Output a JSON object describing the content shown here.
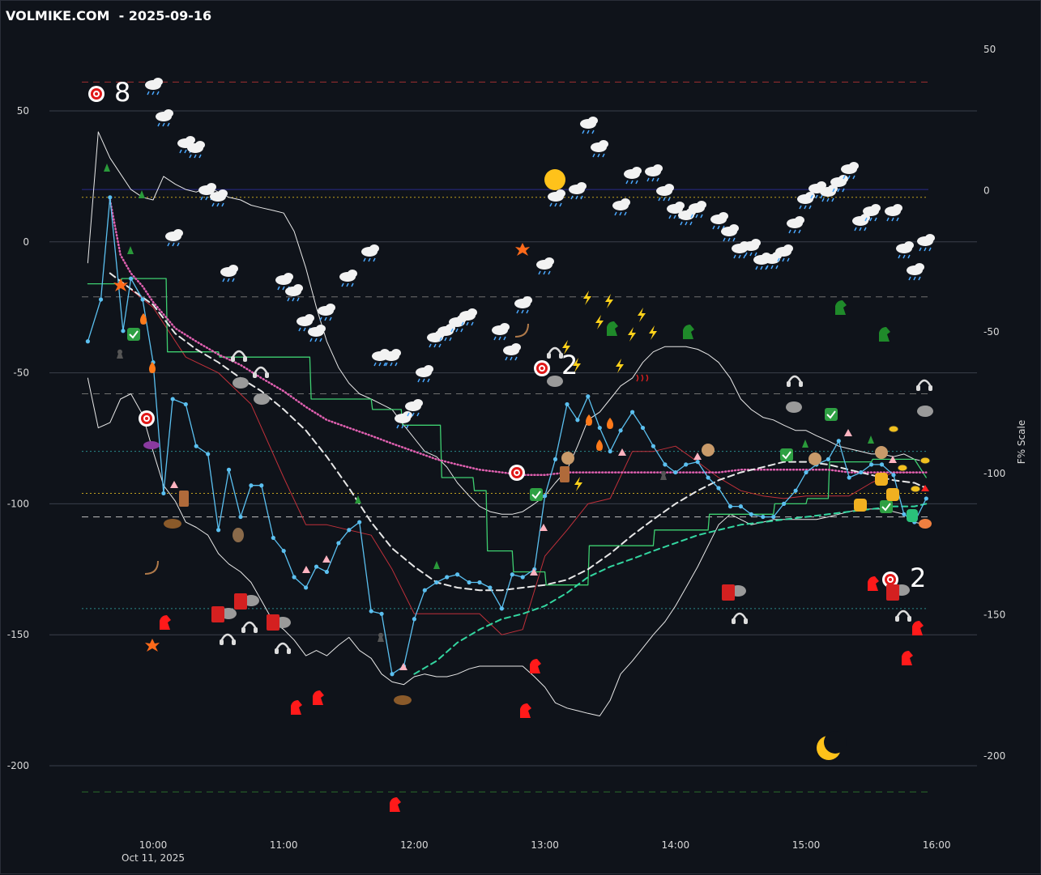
{
  "header": {
    "title": "VOLMIKE.COM  - 2025-09-16"
  },
  "chart_data": {
    "type": "line",
    "title": "VOLMIKE.COM  - 2025-09-16",
    "x_date_label": "Oct 11, 2025",
    "x_ticks": [
      "10:00",
      "11:00",
      "12:00",
      "13:00",
      "14:00",
      "15:00",
      "16:00"
    ],
    "y_left_ticks": [
      "50",
      "0",
      "-50",
      "-100",
      "-150",
      "-200"
    ],
    "y_left_values": [
      50,
      0,
      -50,
      -100,
      -150,
      -200
    ],
    "y_left_range": [
      -220,
      62
    ],
    "y_right_label": "F% Scale",
    "y_right_ticks": [
      "50",
      "0",
      "-50",
      "-100",
      "-150",
      "-200"
    ],
    "y_right_values": [
      50,
      0,
      -50,
      -100,
      -150,
      -200
    ],
    "y_right_range": [
      -215,
      50
    ],
    "grid": true,
    "colors": {
      "background": "#0f131a",
      "price": "#5bc0f0",
      "bands": "#e8e8e8",
      "pink": "#e060b0",
      "green": "#3ecf70",
      "red": "#c0303a",
      "purple": "#8a2a9a",
      "teal": "#33d6a0",
      "white_dash": "#e8e8e8"
    },
    "hlines": [
      {
        "y": 61,
        "color": "#a03030",
        "style": "dash"
      },
      {
        "y": 20,
        "color": "#2a2a8a",
        "style": "solid"
      },
      {
        "y": 17,
        "color": "#c0a020",
        "style": "dot"
      },
      {
        "y": -21,
        "color": "#707070",
        "style": "dash"
      },
      {
        "y": -58,
        "color": "#707070",
        "style": "dash"
      },
      {
        "y": -80,
        "color": "#2a8a8a",
        "style": "dot"
      },
      {
        "y": -96,
        "color": "#c0a020",
        "style": "dot"
      },
      {
        "y": -105,
        "color": "#c0c0c0",
        "style": "dash"
      },
      {
        "y": -140,
        "color": "#2a8a8a",
        "style": "dot"
      },
      {
        "y": -210,
        "color": "#2a6a2a",
        "style": "dash"
      }
    ],
    "series": [
      {
        "key": "price",
        "x": [
          9.5,
          9.6,
          9.67,
          9.77,
          9.83,
          9.92,
          10.0,
          10.08,
          10.15,
          10.25,
          10.33,
          10.42,
          10.5,
          10.58,
          10.67,
          10.75,
          10.83,
          10.92,
          11.0,
          11.08,
          11.17,
          11.25,
          11.33,
          11.42,
          11.5,
          11.58,
          11.67,
          11.75,
          11.83,
          11.92,
          12.0,
          12.08,
          12.17,
          12.25,
          12.33,
          12.42,
          12.5,
          12.58,
          12.67,
          12.75,
          12.83,
          12.92,
          13.0,
          13.08,
          13.17,
          13.25,
          13.33,
          13.42,
          13.5,
          13.58,
          13.67,
          13.75,
          13.83,
          13.92,
          14.0,
          14.08,
          14.17,
          14.25,
          14.33,
          14.42,
          14.5,
          14.58,
          14.67,
          14.75,
          14.83,
          14.92,
          15.0,
          15.08,
          15.17,
          15.25,
          15.33,
          15.42,
          15.5,
          15.58,
          15.67,
          15.75,
          15.83,
          15.92
        ],
        "y": [
          -38,
          -22,
          17,
          -34,
          -14,
          -22,
          -46,
          -96,
          -60,
          -62,
          -78,
          -81,
          -110,
          -87,
          -105,
          -93,
          -93,
          -113,
          -118,
          -128,
          -132,
          -124,
          -126,
          -115,
          -110,
          -107,
          -141,
          -142,
          -165,
          -162,
          -144,
          -133,
          -130,
          -128,
          -127,
          -130,
          -130,
          -132,
          -140,
          -127,
          -128,
          -125,
          -97,
          -83,
          -62,
          -68,
          -59,
          -71,
          -80,
          -72,
          -65,
          -71,
          -78,
          -85,
          -88,
          -85,
          -84,
          -90,
          -94,
          -101,
          -101,
          -104,
          -105,
          -105,
          -100,
          -95,
          -88,
          -85,
          -83,
          -76,
          -90,
          -88,
          -85,
          -85,
          -89,
          -104,
          -107,
          -98
        ]
      },
      {
        "key": "band_upper",
        "x": [
          9.5,
          9.58,
          9.67,
          9.75,
          9.83,
          9.92,
          10.0,
          10.08,
          10.17,
          10.25,
          10.33,
          10.42,
          10.5,
          10.58,
          10.67,
          10.75,
          10.83,
          10.92,
          11.0,
          11.08,
          11.17,
          11.25,
          11.33,
          11.42,
          11.5,
          11.58,
          11.67,
          11.75,
          11.83,
          11.92,
          12.0,
          12.08,
          12.17,
          12.25,
          12.33,
          12.42,
          12.5,
          12.58,
          12.67,
          12.75,
          12.83,
          12.92,
          13.0,
          13.08,
          13.17,
          13.25,
          13.33,
          13.42,
          13.5,
          13.58,
          13.67,
          13.75,
          13.83,
          13.92,
          14.0,
          14.08,
          14.17,
          14.25,
          14.33,
          14.42,
          14.5,
          14.58,
          14.67,
          14.75,
          14.83,
          14.92,
          15.0,
          15.08,
          15.17,
          15.25,
          15.33,
          15.42,
          15.5,
          15.58,
          15.67,
          15.75,
          15.83,
          15.92
        ],
        "y": [
          -8,
          42,
          32,
          26,
          20,
          17,
          16,
          25,
          22,
          20,
          19,
          21,
          19,
          17,
          16,
          14,
          13,
          12,
          11,
          4,
          -10,
          -25,
          -38,
          -48,
          -54,
          -58,
          -60,
          -62,
          -64,
          -70,
          -75,
          -80,
          -82,
          -86,
          -92,
          -97,
          -101,
          -103,
          -104,
          -104,
          -103,
          -100,
          -97,
          -92,
          -87,
          -78,
          -68,
          -65,
          -60,
          -55,
          -52,
          -46,
          -42,
          -40,
          -40,
          -40,
          -41,
          -43,
          -46,
          -52,
          -60,
          -64,
          -67,
          -68,
          -70,
          -72,
          -72,
          -74,
          -76,
          -78,
          -79,
          -80,
          -81,
          -81,
          -82,
          -81,
          -83,
          -84
        ]
      },
      {
        "key": "band_lower",
        "x": [
          9.5,
          9.58,
          9.67,
          9.75,
          9.83,
          9.92,
          10.0,
          10.08,
          10.17,
          10.25,
          10.33,
          10.42,
          10.5,
          10.58,
          10.67,
          10.75,
          10.83,
          10.92,
          11.0,
          11.08,
          11.17,
          11.25,
          11.33,
          11.42,
          11.5,
          11.58,
          11.67,
          11.75,
          11.83,
          11.92,
          12.0,
          12.08,
          12.17,
          12.25,
          12.33,
          12.42,
          12.5,
          12.58,
          12.67,
          12.75,
          12.83,
          12.92,
          13.0,
          13.08,
          13.17,
          13.25,
          13.33,
          13.42,
          13.5,
          13.58,
          13.67,
          13.75,
          13.83,
          13.92,
          14.0,
          14.08,
          14.17,
          14.25,
          14.33,
          14.42,
          14.5,
          14.58,
          14.67,
          14.75,
          14.83,
          14.92,
          15.0,
          15.08,
          15.17,
          15.25,
          15.33,
          15.42,
          15.5,
          15.58,
          15.67,
          15.75,
          15.83,
          15.92
        ],
        "y": [
          -52,
          -71,
          -69,
          -60,
          -58,
          -66,
          -80,
          -93,
          -99,
          -107,
          -109,
          -112,
          -119,
          -123,
          -126,
          -130,
          -137,
          -145,
          -148,
          -152,
          -158,
          -156,
          -158,
          -154,
          -151,
          -156,
          -159,
          -165,
          -168,
          -169,
          -166,
          -165,
          -166,
          -166,
          -165,
          -163,
          -162,
          -162,
          -162,
          -162,
          -162,
          -166,
          -170,
          -176,
          -178,
          -179,
          -180,
          -181,
          -175,
          -165,
          -160,
          -155,
          -150,
          -145,
          -139,
          -132,
          -124,
          -116,
          -108,
          -104,
          -106,
          -108,
          -107,
          -106,
          -106,
          -106,
          -106,
          -106,
          -105,
          -104,
          -103,
          -102,
          -102,
          -102,
          -103,
          -104,
          -107,
          -108
        ]
      },
      {
        "key": "pink_dotted",
        "x": [
          9.67,
          9.75,
          9.83,
          9.92,
          10.0,
          10.17,
          10.33,
          10.5,
          10.67,
          10.83,
          11.0,
          11.17,
          11.33,
          11.5,
          11.67,
          11.83,
          12.0,
          12.17,
          12.33,
          12.5,
          12.67,
          12.83,
          13.0,
          13.17,
          13.33,
          13.5,
          13.67,
          13.83,
          14.0,
          14.17,
          14.33,
          14.5,
          14.67,
          14.83,
          15.0,
          15.17,
          15.33,
          15.5,
          15.67,
          15.83,
          15.92
        ],
        "y": [
          16,
          -5,
          -12,
          -17,
          -23,
          -33,
          -38,
          -43,
          -47,
          -52,
          -57,
          -63,
          -68,
          -71,
          -74,
          -77,
          -80,
          -83,
          -85,
          -87,
          -88,
          -89,
          -89,
          -88,
          -88,
          -88,
          -88,
          -88,
          -88,
          -88,
          -88,
          -87,
          -87,
          -87,
          -87,
          -87,
          -88,
          -88,
          -88,
          -88,
          -88
        ]
      },
      {
        "key": "white_dashed",
        "x": [
          9.67,
          9.83,
          10.0,
          10.17,
          10.33,
          10.5,
          10.67,
          10.83,
          11.0,
          11.17,
          11.33,
          11.5,
          11.67,
          11.83,
          12.0,
          12.17,
          12.33,
          12.5,
          12.67,
          12.83,
          13.0,
          13.17,
          13.33,
          13.5,
          13.67,
          13.83,
          14.0,
          14.17,
          14.33,
          14.5,
          14.67,
          14.83,
          15.0,
          15.17,
          15.33,
          15.5,
          15.67,
          15.83,
          15.92
        ],
        "y": [
          -12,
          -18,
          -24,
          -35,
          -41,
          -46,
          -52,
          -57,
          -64,
          -72,
          -82,
          -94,
          -107,
          -117,
          -124,
          -130,
          -132,
          -133,
          -133,
          -132,
          -131,
          -129,
          -125,
          -119,
          -112,
          -106,
          -100,
          -95,
          -91,
          -88,
          -86,
          -84,
          -84,
          -85,
          -87,
          -89,
          -91,
          -92,
          -94
        ]
      },
      {
        "key": "teal_dashed",
        "x": [
          12.0,
          12.17,
          12.33,
          12.5,
          12.67,
          12.83,
          13.0,
          13.17,
          13.33,
          13.5,
          13.67,
          13.83,
          14.0,
          14.17,
          14.33,
          14.5,
          14.67,
          14.83,
          15.0,
          15.17,
          15.33,
          15.5,
          15.67,
          15.83,
          15.92
        ],
        "y": [
          -165,
          -160,
          -153,
          -148,
          -144,
          -142,
          -139,
          -134,
          -128,
          -124,
          -121,
          -118,
          -115,
          -112,
          -110,
          -108,
          -107,
          -106,
          -105,
          -104,
          -103,
          -102,
          -101,
          -101,
          -100
        ]
      },
      {
        "key": "green_step",
        "x": [
          9.5,
          9.75,
          9.76,
          10.1,
          10.11,
          10.5,
          10.51,
          10.83,
          10.84,
          11.2,
          11.21,
          11.67,
          11.68,
          11.9,
          11.91,
          12.2,
          12.21,
          12.45,
          12.46,
          12.55,
          12.56,
          12.75,
          12.76,
          13.0,
          13.01,
          13.33,
          13.34,
          13.83,
          13.84,
          14.25,
          14.26,
          14.75,
          14.76,
          15.0,
          15.01,
          15.17,
          15.18,
          15.5,
          15.51,
          15.83,
          15.92
        ],
        "y": [
          -16,
          -16,
          -14,
          -14,
          -42,
          -42,
          -44,
          -44,
          -44,
          -44,
          -60,
          -60,
          -64,
          -64,
          -70,
          -70,
          -90,
          -90,
          -95,
          -95,
          -118,
          -118,
          -126,
          -126,
          -131,
          -131,
          -116,
          -116,
          -110,
          -110,
          -104,
          -104,
          -100,
          -100,
          -98,
          -98,
          -84,
          -84,
          -83,
          -83,
          -90
        ]
      },
      {
        "key": "red_line",
        "x": [
          9.75,
          10.0,
          10.25,
          10.5,
          10.75,
          11.0,
          11.17,
          11.33,
          11.5,
          11.67,
          11.83,
          12.0,
          12.17,
          12.33,
          12.5,
          12.67,
          12.83,
          13.0,
          13.17,
          13.33,
          13.5,
          13.67,
          13.83,
          14.0,
          14.17,
          14.33,
          14.5,
          14.67,
          14.83,
          15.0,
          15.17,
          15.33,
          15.5,
          15.67,
          15.83
        ],
        "y": [
          -15,
          -25,
          -44,
          -50,
          -62,
          -90,
          -108,
          -108,
          -110,
          -112,
          -125,
          -142,
          -142,
          -142,
          -142,
          -150,
          -148,
          -120,
          -110,
          -100,
          -98,
          -80,
          -80,
          -78,
          -84,
          -90,
          -95,
          -97,
          -98,
          -97,
          -97,
          -97,
          -92,
          -88,
          -88
        ]
      }
    ],
    "annotations_text": [
      "8",
      "2",
      "2"
    ]
  }
}
